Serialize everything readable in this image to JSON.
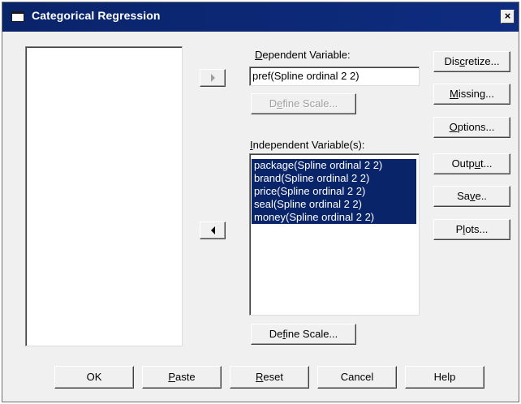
{
  "window": {
    "title": "Categorical Regression",
    "close_glyph": "×"
  },
  "dependent": {
    "label_pre": "",
    "label_u": "D",
    "label_post": "ependent Variable:",
    "value": "pref(Spline ordinal 2 2)",
    "define_scale_pre": "D",
    "define_scale_u": "e",
    "define_scale_post": "fine Scale..."
  },
  "independent": {
    "label_pre": "",
    "label_u": "I",
    "label_post": "ndependent Variable(s):",
    "items": [
      "package(Spline ordinal 2 2)",
      "brand(Spline ordinal 2 2)",
      "price(Spline ordinal 2 2)",
      "seal(Spline ordinal 2 2)",
      "money(Spline ordinal 2 2)"
    ],
    "define_scale_pre": "De",
    "define_scale_u": "f",
    "define_scale_post": "ine Scale..."
  },
  "side_buttons": {
    "discretize": {
      "pre": "Dis",
      "u": "c",
      "post": "retize..."
    },
    "missing": {
      "pre": "",
      "u": "M",
      "post": "issing..."
    },
    "options": {
      "pre": "",
      "u": "O",
      "post": "ptions..."
    },
    "output": {
      "pre": "Outp",
      "u": "u",
      "post": "t..."
    },
    "save": {
      "pre": "Sa",
      "u": "v",
      "post": "e.."
    },
    "plots": {
      "pre": "P",
      "u": "l",
      "post": "ots..."
    }
  },
  "bottom_buttons": {
    "ok": {
      "pre": "OK",
      "u": "",
      "post": ""
    },
    "paste": {
      "pre": "",
      "u": "P",
      "post": "aste"
    },
    "reset": {
      "pre": "",
      "u": "R",
      "post": "eset"
    },
    "cancel": {
      "pre": "Cancel",
      "u": "",
      "post": ""
    },
    "help": {
      "pre": "Help",
      "u": "",
      "post": ""
    }
  },
  "icons": {
    "move_right": "arrow-right-icon",
    "move_left": "arrow-left-icon"
  },
  "colors": {
    "titlebar": "#0a246a",
    "selection": "#0a246a",
    "dialog_bg": "#f0f0f0"
  }
}
